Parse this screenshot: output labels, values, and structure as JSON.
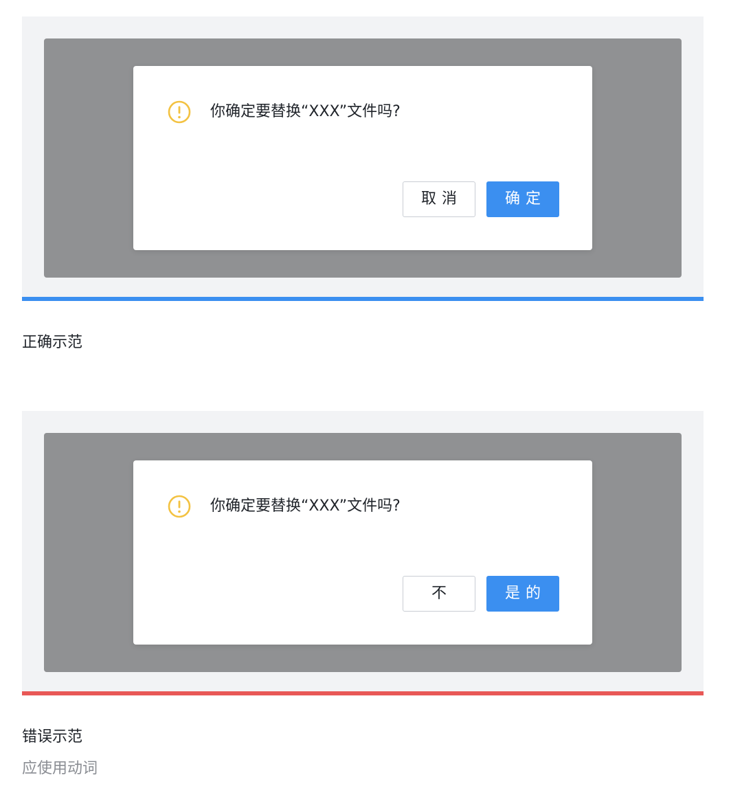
{
  "examples": [
    {
      "kind": "correct",
      "dialog": {
        "message": "你确定要替换“XXX”文件吗?",
        "cancel_label": "取消",
        "confirm_label": "确定",
        "icon": "warning-circle-icon"
      },
      "bar_color": "#3b8ff0",
      "caption": "正确示范"
    },
    {
      "kind": "incorrect",
      "dialog": {
        "message": "你确定要替换“XXX”文件吗?",
        "cancel_label": "不",
        "confirm_label": "是的",
        "icon": "warning-circle-icon"
      },
      "bar_color": "#e85856",
      "caption": "错误示范",
      "note": "应使用动词"
    }
  ],
  "colors": {
    "primary": "#3b8ff0",
    "warning": "#f3c242",
    "error_bar": "#e85856",
    "backdrop": "#909193",
    "stage": "#f2f3f5"
  }
}
